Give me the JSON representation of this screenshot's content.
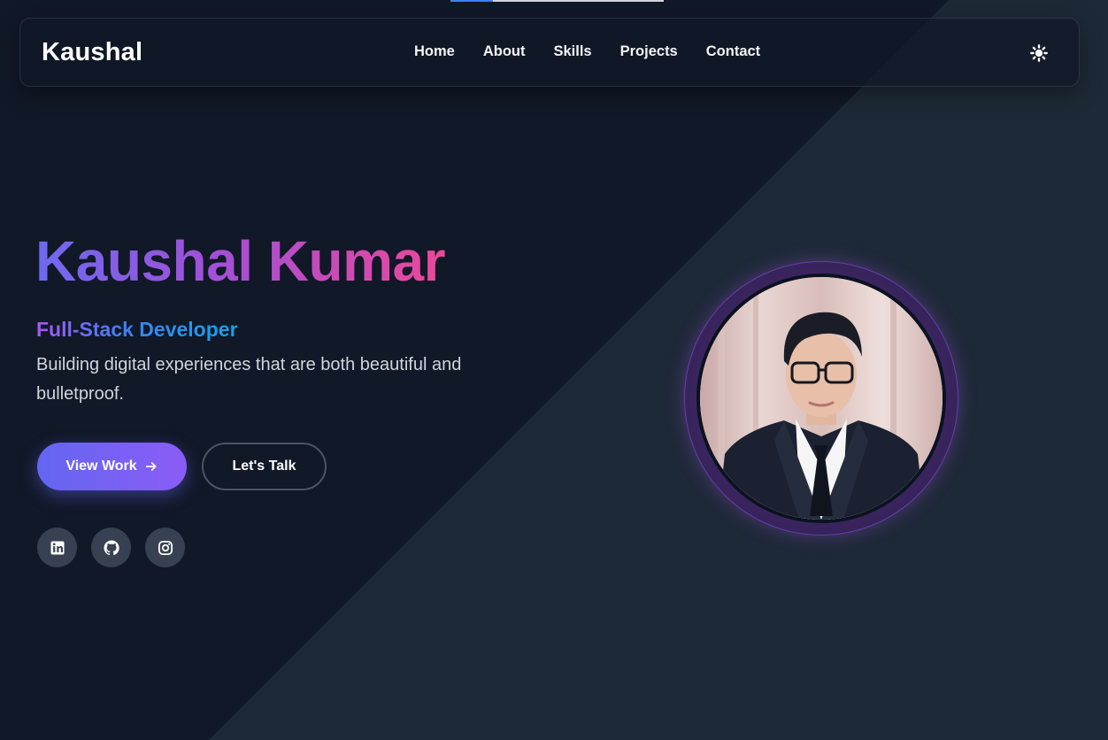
{
  "progress": {
    "fraction": 0.2
  },
  "navbar": {
    "brand": "Kaushal",
    "links": [
      {
        "label": "Home"
      },
      {
        "label": "About"
      },
      {
        "label": "Skills"
      },
      {
        "label": "Projects"
      },
      {
        "label": "Contact"
      }
    ],
    "theme_toggle_icon": "sun-icon"
  },
  "hero": {
    "name": "Kaushal Kumar",
    "role": "Full-Stack Developer",
    "tagline": "Building digital experiences that are both beautiful and bulletproof.",
    "primary_button": {
      "label": "View Work",
      "icon": "arrow-right-icon"
    },
    "secondary_button": {
      "label": "Let's Talk"
    },
    "socials": [
      {
        "icon": "linkedin-icon"
      },
      {
        "icon": "github-icon"
      },
      {
        "icon": "instagram-icon"
      }
    ]
  },
  "colors": {
    "background_dark": "#111827",
    "background_diagonal": "#1e2937",
    "accent_primary": "#6366f1",
    "accent_pink": "#ec4899",
    "accent_blue": "#3b82f6"
  }
}
